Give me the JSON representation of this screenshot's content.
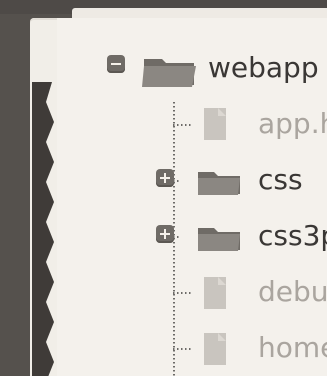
{
  "tree": {
    "root": {
      "label": "webapp",
      "toggle": "collapse-minus",
      "icon": "folder-open-icon"
    },
    "items": [
      {
        "label": "app.h",
        "type": "file",
        "icon": "file-icon"
      },
      {
        "label": "css",
        "type": "folder",
        "toggle": "expand-plus",
        "icon": "folder-icon"
      },
      {
        "label": "css3p",
        "type": "folder",
        "toggle": "expand-plus",
        "icon": "folder-icon"
      },
      {
        "label": "debu",
        "type": "file",
        "icon": "file-icon"
      },
      {
        "label": "home",
        "type": "file",
        "icon": "file-icon"
      }
    ]
  },
  "colors": {
    "background": "#55514d",
    "panel": "#f1eee8",
    "folder": "#6f6b66",
    "file": "#c9c5bf",
    "text": "#3a3735",
    "muted_text": "#aaa59f"
  }
}
